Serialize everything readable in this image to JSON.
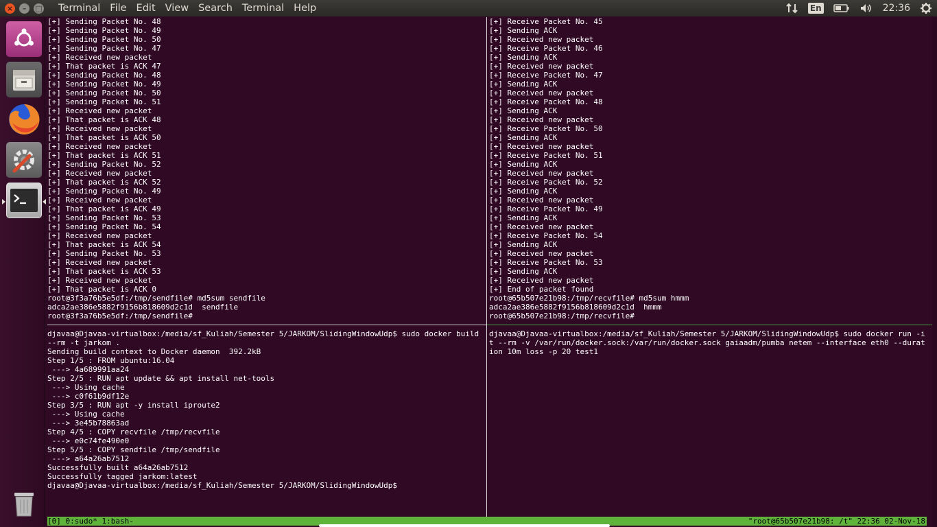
{
  "topbar": {
    "close_glyph": "×",
    "min_glyph": "–",
    "max_glyph": "□",
    "menu": [
      "Terminal",
      "File",
      "Edit",
      "View",
      "Search",
      "Terminal",
      "Help"
    ],
    "lang": "En",
    "clock": "22:36"
  },
  "launcher": {
    "items": [
      "ubuntu-software-icon",
      "files-icon",
      "firefox-icon",
      "system-settings-icon",
      "terminal-icon",
      "trash-icon"
    ]
  },
  "panes": {
    "top_left": [
      "[+] Sending Packet No. 48",
      "[+] Sending Packet No. 49",
      "[+] Sending Packet No. 50",
      "[+] Sending Packet No. 47",
      "[+] Received new packet",
      "[+] That packet is ACK 47",
      "[+] Sending Packet No. 48",
      "[+] Sending Packet No. 49",
      "[+] Sending Packet No. 50",
      "[+] Sending Packet No. 51",
      "[+] Received new packet",
      "[+] That packet is ACK 48",
      "[+] Received new packet",
      "[+] That packet is ACK 50",
      "[+] Received new packet",
      "[+] That packet is ACK 51",
      "[+] Sending Packet No. 52",
      "[+] Received new packet",
      "[+] That packet is ACK 52",
      "[+] Sending Packet No. 49",
      "[+] Received new packet",
      "[+] That packet is ACK 49",
      "[+] Sending Packet No. 53",
      "[+] Sending Packet No. 54",
      "[+] Received new packet",
      "[+] That packet is ACK 54",
      "[+] Sending Packet No. 53",
      "[+] Received new packet",
      "[+] That packet is ACK 53",
      "[+] Received new packet",
      "[+] That packet is ACK 0",
      "root@3f3a76b5e5df:/tmp/sendfile# md5sum sendfile",
      "adca2ae386e5882f9156b818609d2c1d  sendfile",
      "root@3f3a76b5e5df:/tmp/sendfile#"
    ],
    "top_right": [
      "[+] Receive Packet No. 45",
      "[+] Sending ACK",
      "[+] Received new packet",
      "[+] Receive Packet No. 46",
      "[+] Sending ACK",
      "[+] Received new packet",
      "[+] Receive Packet No. 47",
      "[+] Sending ACK",
      "[+] Received new packet",
      "[+] Receive Packet No. 48",
      "[+] Sending ACK",
      "[+] Received new packet",
      "[+] Receive Packet No. 50",
      "[+] Sending ACK",
      "[+] Received new packet",
      "[+] Receive Packet No. 51",
      "[+] Sending ACK",
      "[+] Received new packet",
      "[+] Receive Packet No. 52",
      "[+] Sending ACK",
      "[+] Received new packet",
      "[+] Receive Packet No. 49",
      "[+] Sending ACK",
      "[+] Received new packet",
      "[+] Receive Packet No. 54",
      "[+] Sending ACK",
      "[+] Received new packet",
      "[+] Receive Packet No. 53",
      "[+] Sending ACK",
      "[+] Received new packet",
      "[+] End of packet found",
      "root@65b507e21b98:/tmp/recvfile# md5sum hmmm",
      "adca2ae386e5882f9156b818609d2c1d  hmmm",
      "root@65b507e21b98:/tmp/recvfile#"
    ],
    "bottom_left": "djavaa@Djavaa-virtualbox:/media/sf_Kuliah/Semester 5/JARKOM/SlidingWindowUdp$ sudo docker build --rm -t jarkom .\nSending build context to Docker daemon  392.2kB\nStep 1/5 : FROM ubuntu:16.04\n ---> 4a689991aa24\nStep 2/5 : RUN apt update && apt install net-tools\n ---> Using cache\n ---> c0f61b9df12e\nStep 3/5 : RUN apt -y install iproute2\n ---> Using cache\n ---> 3e45b78863ad\nStep 4/5 : COPY recvfile /tmp/recvfile\n ---> e0c74fe490e0\nStep 5/5 : COPY sendfile /tmp/sendfile\n ---> a64a26ab7512\nSuccessfully built a64a26ab7512\nSuccessfully tagged jarkom:latest\ndjavaa@Djavaa-virtualbox:/media/sf_Kuliah/Semester 5/JARKOM/SlidingWindowUdp$",
    "bottom_right": "djavaa@Djavaa-virtualbox:/media/sf_Kuliah/Semester 5/JARKOM/SlidingWindowUdp$ sudo docker run -it --rm -v /var/run/docker.sock:/var/run/docker.sock gaiaadm/pumba netem --interface eth0 --duration 10m loss -p 20 test1"
  },
  "tmux": {
    "left": "[0] 0:sudo* 1:bash-",
    "right": "\"root@65b507e21b98: /t\" 22:36 02-Nov-18"
  },
  "colors": {
    "terminal_bg": "#300a24",
    "status_green": "#5fb33b",
    "close_orange": "#e9541f"
  }
}
